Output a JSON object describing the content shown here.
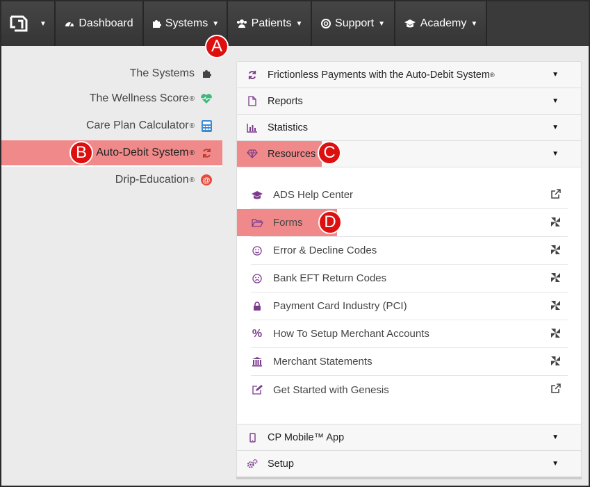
{
  "topnav": {
    "items": [
      {
        "label": "Dashboard"
      },
      {
        "label": "Systems"
      },
      {
        "label": "Patients"
      },
      {
        "label": "Support"
      },
      {
        "label": "Academy"
      }
    ]
  },
  "sidebar": {
    "items": [
      {
        "label": "The Systems",
        "reg": ""
      },
      {
        "label": "The Wellness Score",
        "reg": "®"
      },
      {
        "label": "Care Plan Calculator",
        "reg": "®"
      },
      {
        "label": "Auto-Debit System",
        "reg": "®"
      },
      {
        "label": "Drip-Education",
        "reg": "®"
      }
    ]
  },
  "accordion": {
    "sections": [
      {
        "label": "Frictionless Payments with the Auto-Debit System",
        "reg": "®"
      },
      {
        "label": "Reports"
      },
      {
        "label": "Statistics"
      },
      {
        "label": "Resources"
      },
      {
        "label": "CP Mobile™ App"
      },
      {
        "label": "Setup"
      }
    ]
  },
  "resources": {
    "items": [
      {
        "label": "ADS Help Center"
      },
      {
        "label": "Forms"
      },
      {
        "label": "Error & Decline Codes"
      },
      {
        "label": "Bank EFT Return Codes"
      },
      {
        "label": "Payment Card Industry (PCI)"
      },
      {
        "label": "How To Setup Merchant Accounts"
      },
      {
        "label": "Merchant Statements"
      },
      {
        "label": "Get Started with Genesis"
      }
    ]
  },
  "badges": {
    "a": "A",
    "b": "B",
    "c": "C",
    "d": "D"
  },
  "colors": {
    "accent_purple": "#7b3a8c",
    "highlight": "#f08a8a",
    "badge_red": "#dd0f0f",
    "nav_bg": "#3a3a3a"
  }
}
